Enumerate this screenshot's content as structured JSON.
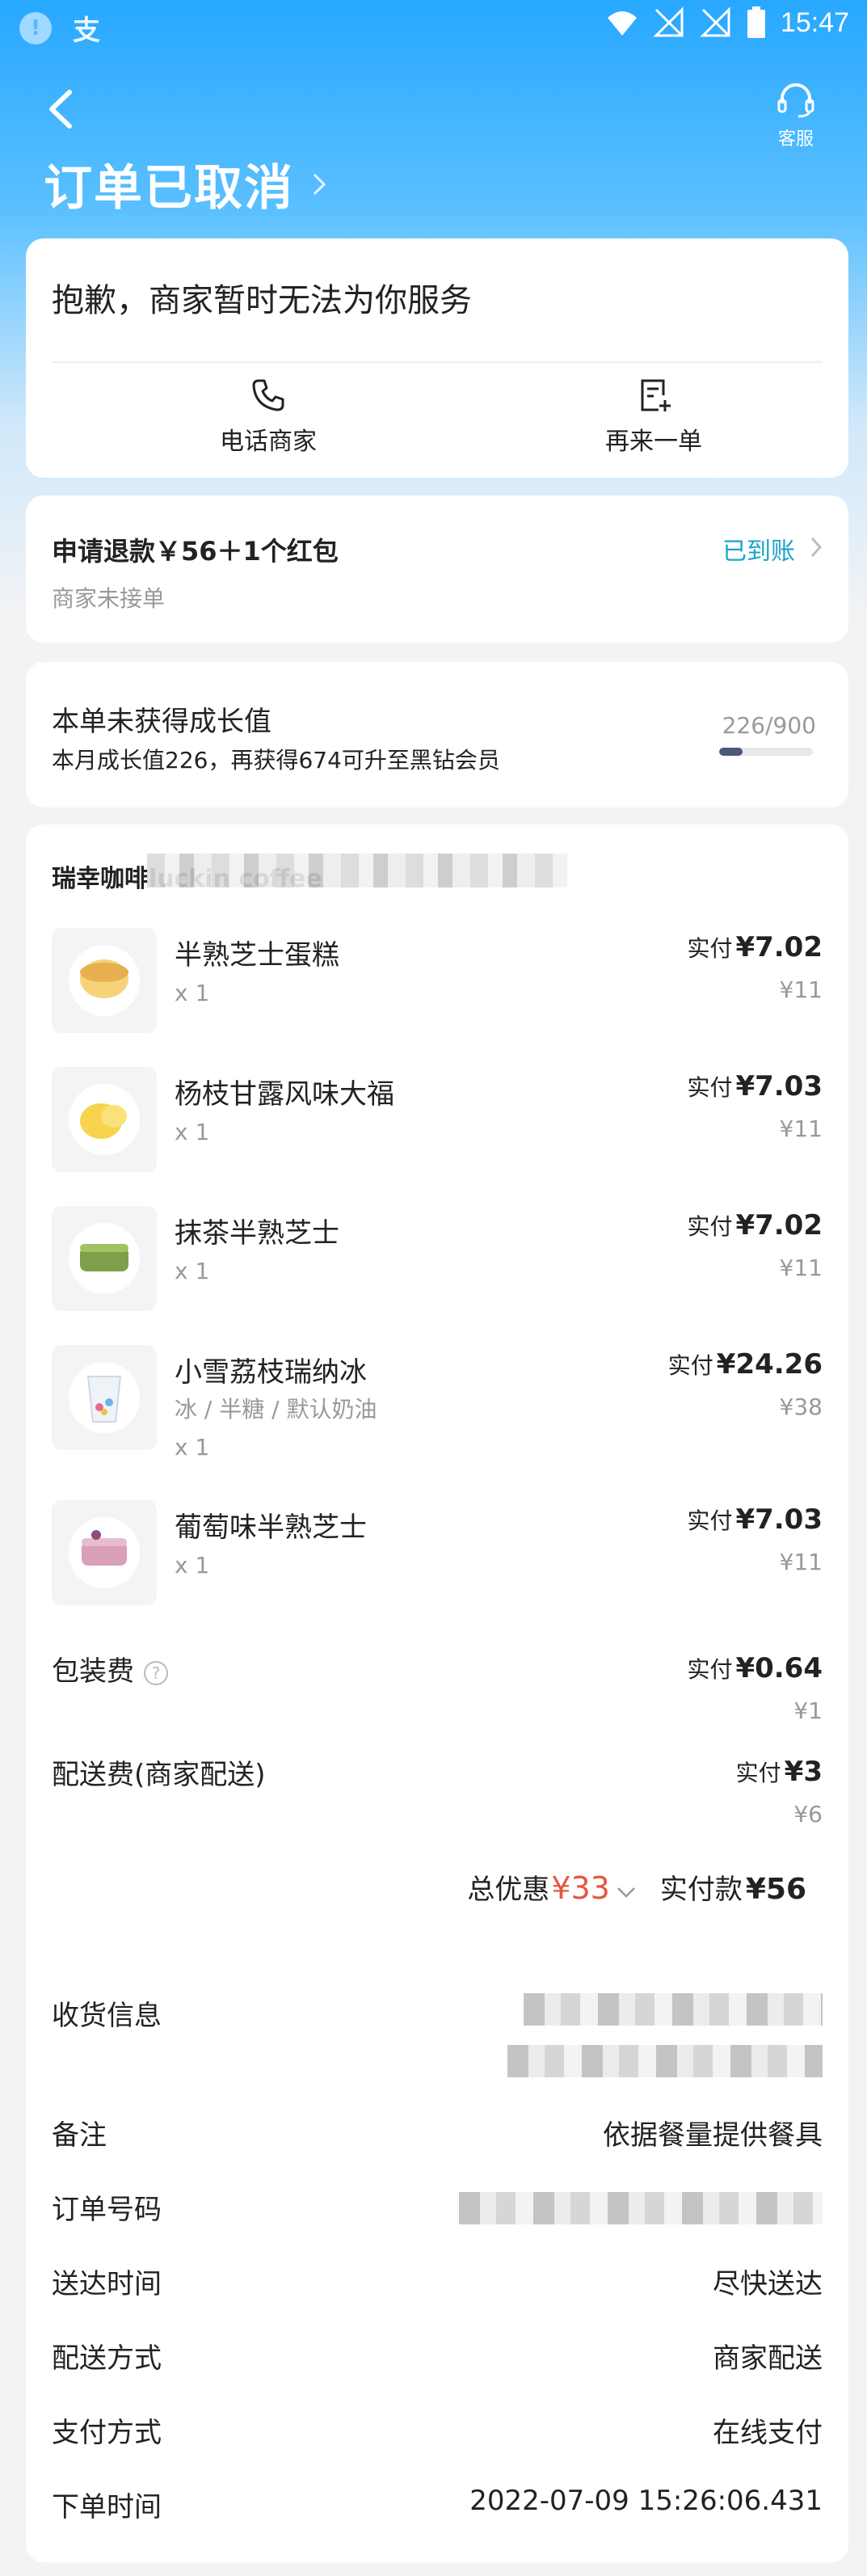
{
  "status_bar": {
    "time": "15:47"
  },
  "header": {
    "title": "订单已取消",
    "service_label": "客服"
  },
  "merchant_card": {
    "message": "抱歉，商家暂时无法为你服务",
    "call_label": "电话商家",
    "reorder_label": "再来一单"
  },
  "refund": {
    "title": "申请退款￥56＋1个红包",
    "status": "已到账",
    "subtitle": "商家未接单"
  },
  "growth": {
    "title": "本单未获得成长值",
    "subtitle": "本月成长值226，再获得674可升至黑钻会员",
    "progress_text": "226/900",
    "progress_fraction": 0.251
  },
  "order": {
    "store_name": "瑞幸咖啡luckin coffee",
    "paid_prefix": "实付",
    "items": [
      {
        "name": "半熟芝士蛋糕",
        "spec": "",
        "qty": "x 1",
        "paid": "¥7.02",
        "original": "¥11"
      },
      {
        "name": "杨枝甘露风味大福",
        "spec": "",
        "qty": "x 1",
        "paid": "¥7.03",
        "original": "¥11"
      },
      {
        "name": "抹茶半熟芝士",
        "spec": "",
        "qty": "x 1",
        "paid": "¥7.02",
        "original": "¥11"
      },
      {
        "name": "小雪荔枝瑞纳冰",
        "spec": "冰 / 半糖 / 默认奶油",
        "qty": "x 1",
        "paid": "¥24.26",
        "original": "¥38"
      },
      {
        "name": "葡萄味半熟芝士",
        "spec": "",
        "qty": "x 1",
        "paid": "¥7.03",
        "original": "¥11"
      }
    ],
    "packaging": {
      "label": "包装费",
      "paid": "¥0.64",
      "original": "¥1"
    },
    "delivery_fee": {
      "label": "配送费(商家配送)",
      "paid": "¥3",
      "original": "¥6"
    },
    "summary": {
      "discount_label": "总优惠",
      "discount_value": "¥33",
      "total_label": "实付款",
      "total_value": "¥56"
    }
  },
  "details": {
    "address_label": "收货信息",
    "remark_label": "备注",
    "remark_value": "依据餐量提供餐具",
    "order_no_label": "订单号码",
    "delivery_time_label": "送达时间",
    "delivery_time_value": "尽快送达",
    "delivery_method_label": "配送方式",
    "delivery_method_value": "商家配送",
    "payment_label": "支付方式",
    "payment_value": "在线支付",
    "order_time_label": "下单时间",
    "order_time_value": "2022-07-09 15:26:06.431"
  }
}
